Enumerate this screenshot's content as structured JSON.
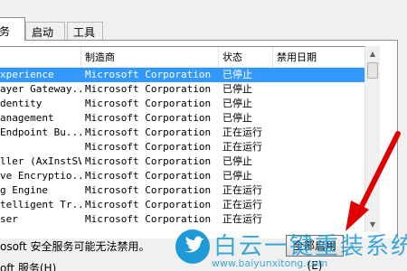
{
  "tabs": [
    {
      "label": "务",
      "active": true
    },
    {
      "label": "启动",
      "active": false
    },
    {
      "label": "工具",
      "active": false
    }
  ],
  "columns": {
    "service": "",
    "manufacturer": "制造商",
    "state": "状态",
    "disabled_date": "禁用日期"
  },
  "rows": [
    {
      "name": "xperience",
      "maker": "Microsoft Corporation",
      "state": "已停止",
      "date": "",
      "selected": true
    },
    {
      "name": "ayer Gateway...",
      "maker": "Microsoft Corporation",
      "state": "已停止",
      "date": ""
    },
    {
      "name": "dentity",
      "maker": "Microsoft Corporation",
      "state": "已停止",
      "date": ""
    },
    {
      "name": "anagement",
      "maker": "Microsoft Corporation",
      "state": "已停止",
      "date": ""
    },
    {
      "name": " Endpoint Bu...",
      "maker": "Microsoft Corporation",
      "state": "正在运行",
      "date": ""
    },
    {
      "name": "",
      "maker": "Microsoft Corporation",
      "state": "正在运行",
      "date": ""
    },
    {
      "name": "ller (AxInstSV)",
      "maker": "Microsoft Corporation",
      "state": "已停止",
      "date": ""
    },
    {
      "name": "ve Encryptio...",
      "maker": "Microsoft Corporation",
      "state": "已停止",
      "date": ""
    },
    {
      "name": "g Engine",
      "maker": "Microsoft Corporation",
      "state": "正在运行",
      "date": ""
    },
    {
      "name": "telligent Tr...",
      "maker": "Microsoft Corporation",
      "state": "正在运行",
      "date": ""
    },
    {
      "name": "ser",
      "maker": "Microsoft Corporation",
      "state": "正在运行",
      "date": ""
    }
  ],
  "footer": {
    "note": "osoft 安全服务可能无法禁用。",
    "hide_ms_label": "oft 服务(H)",
    "enable_all_button": "全部启用(E)"
  },
  "watermark": {
    "title": "白云一键重装系统",
    "url": "www.baiyunxitong.com",
    "icon": "twitter-bird-icon"
  },
  "colors": {
    "selection": "#3399ff",
    "annotation_arrow": "#e00000",
    "watermark": "#1e9ad6"
  }
}
